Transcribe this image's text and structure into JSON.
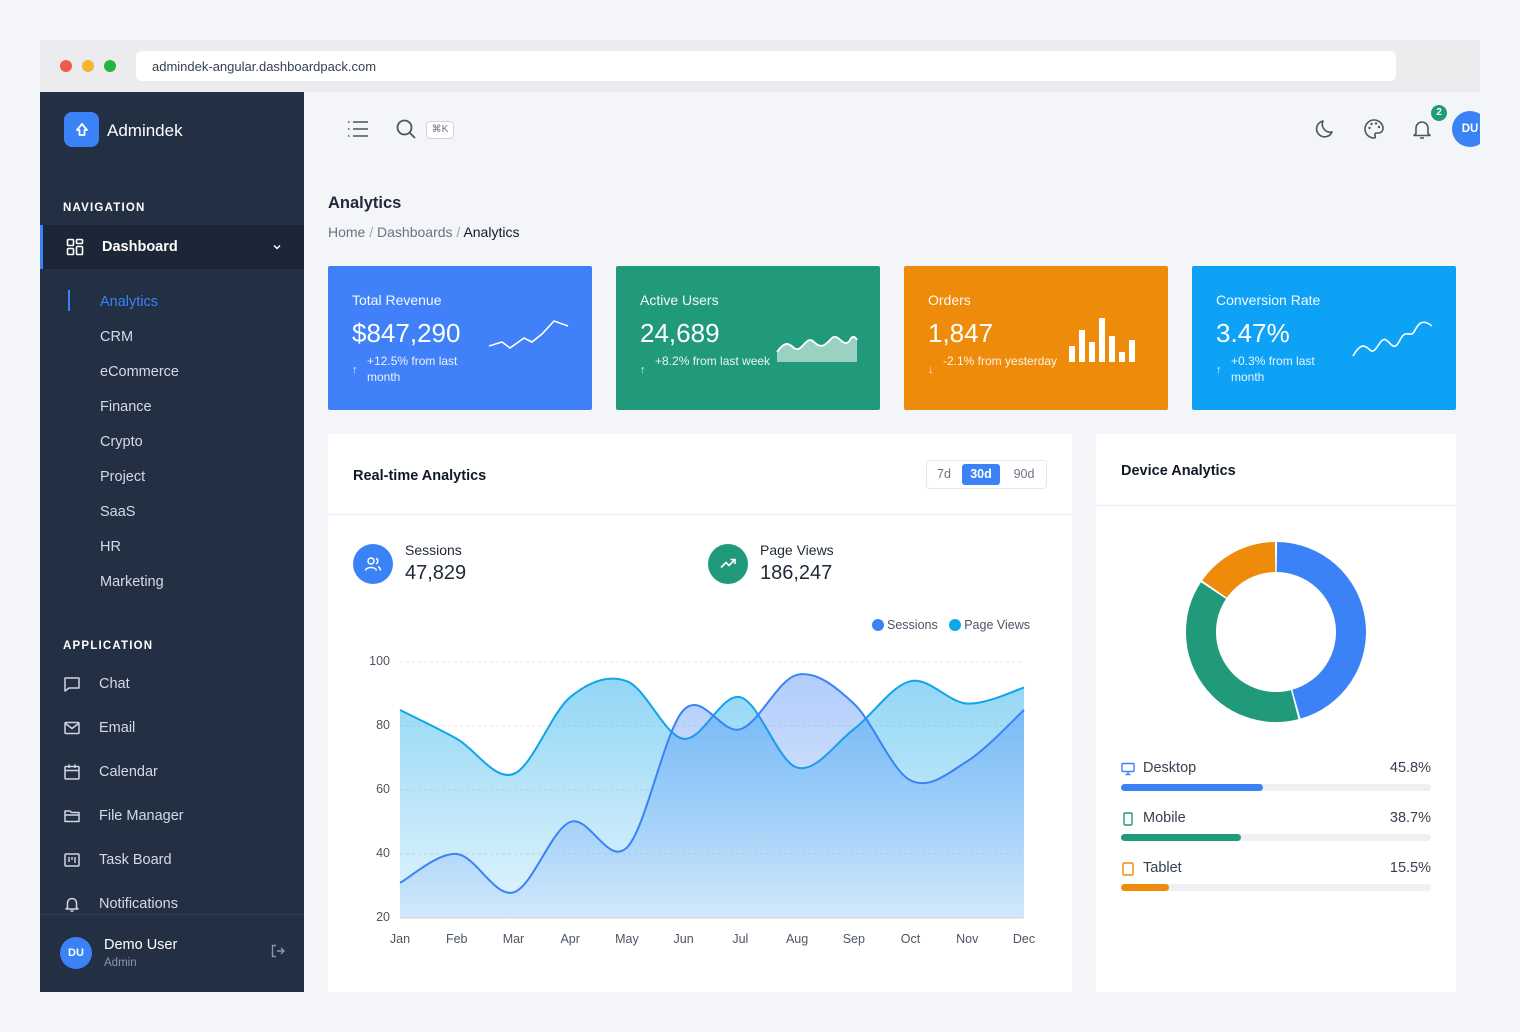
{
  "browser": {
    "url": "admindek-angular.dashboardpack.com"
  },
  "sidebar": {
    "brand": "Admindek",
    "nav_section": "NAVIGATION",
    "dashboard_label": "Dashboard",
    "sub_items": [
      "Analytics",
      "CRM",
      "eCommerce",
      "Finance",
      "Crypto",
      "Project",
      "SaaS",
      "HR",
      "Marketing"
    ],
    "app_section": "APPLICATION",
    "app_items": [
      {
        "label": "Chat",
        "icon": "chat-icon"
      },
      {
        "label": "Email",
        "icon": "mail-icon"
      },
      {
        "label": "Calendar",
        "icon": "calendar-icon"
      },
      {
        "label": "File Manager",
        "icon": "folder-icon"
      },
      {
        "label": "Task Board",
        "icon": "kanban-icon"
      },
      {
        "label": "Notifications",
        "icon": "bell-icon"
      }
    ],
    "user": {
      "initials": "DU",
      "name": "Demo User",
      "role": "Admin"
    }
  },
  "topbar": {
    "shortcut": "⌘K",
    "notif_count": "2",
    "avatar_initials": "DU"
  },
  "page": {
    "title": "Analytics",
    "breadcrumb": [
      "Home",
      "Dashboards",
      "Analytics"
    ]
  },
  "stats": [
    {
      "title": "Total Revenue",
      "value": "$847,290",
      "change": "+12.5% from last month",
      "direction": "up",
      "color": "#4080f8"
    },
    {
      "title": "Active Users",
      "value": "24,689",
      "change": "+8.2% from last week",
      "direction": "up",
      "color": "#219a7b"
    },
    {
      "title": "Orders",
      "value": "1,847",
      "change": "-2.1% from yesterday",
      "direction": "down",
      "color": "#ef8b0a"
    },
    {
      "title": "Conversion Rate",
      "value": "3.47%",
      "change": "+0.3% from last month",
      "direction": "up",
      "color": "#0ea2f7"
    }
  ],
  "realtime": {
    "title": "Real-time Analytics",
    "ranges": [
      "7d",
      "30d",
      "90d"
    ],
    "selected_range": "30d",
    "sessions_label": "Sessions",
    "sessions_value": "47,829",
    "pageviews_label": "Page Views",
    "pageviews_value": "186,247"
  },
  "chart_data": {
    "type": "area",
    "categories": [
      "Jan",
      "Feb",
      "Mar",
      "Apr",
      "May",
      "Jun",
      "Jul",
      "Aug",
      "Sep",
      "Oct",
      "Nov",
      "Dec"
    ],
    "series": [
      {
        "name": "Sessions",
        "color": "#3b82f6",
        "values": [
          31,
          40,
          28,
          50,
          42,
          85,
          79,
          96,
          87,
          63,
          69,
          85
        ]
      },
      {
        "name": "Page Views",
        "color": "#0ea5e9",
        "values": [
          85,
          76,
          65,
          89,
          94,
          76,
          89,
          67,
          79,
          94,
          87,
          92
        ]
      }
    ],
    "ylim": [
      20,
      100
    ],
    "yticks": [
      100,
      80,
      60,
      40,
      20
    ],
    "grid": true,
    "legend": "top-right"
  },
  "devices": {
    "title": "Device Analytics",
    "items": [
      {
        "label": "Desktop",
        "percent": "45.8%",
        "value": 45.8,
        "color": "#3b82f6",
        "icon": "monitor-icon"
      },
      {
        "label": "Mobile",
        "percent": "38.7%",
        "value": 38.7,
        "color": "#219a7b",
        "icon": "smartphone-icon"
      },
      {
        "label": "Tablet",
        "percent": "15.5%",
        "value": 15.5,
        "color": "#ef8b0a",
        "icon": "tablet-icon"
      }
    ]
  }
}
